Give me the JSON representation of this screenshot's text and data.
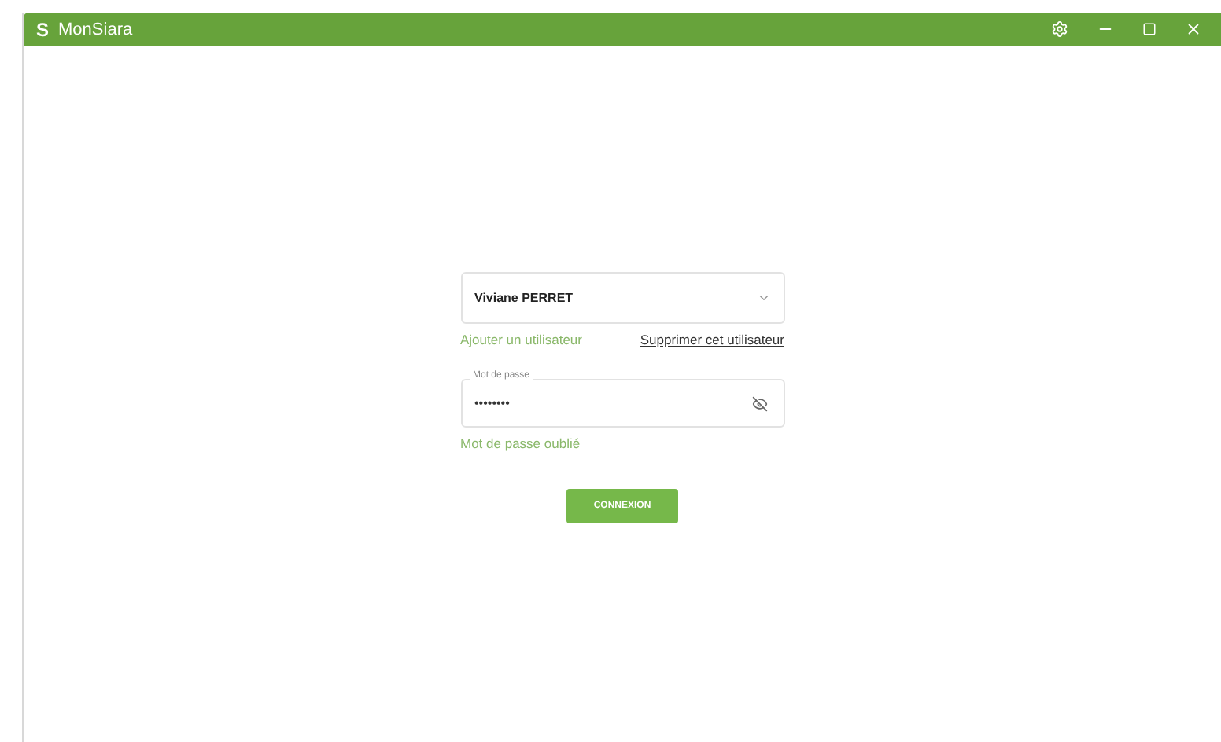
{
  "window": {
    "logo": "S",
    "title": "MonSiara"
  },
  "user_select": {
    "value": "Viviane PERRET"
  },
  "links": [
    {
      "label": "Ajouter un utilisateur",
      "kind": "add"
    },
    {
      "label": "Supprimer cet utilisateur",
      "kind": "remove"
    }
  ],
  "password": {
    "label": "Mot de passe",
    "value": "••••••••",
    "visible": false
  },
  "forgot_link": "Mot de passe oublié",
  "submit_button": "CONNEXION"
}
